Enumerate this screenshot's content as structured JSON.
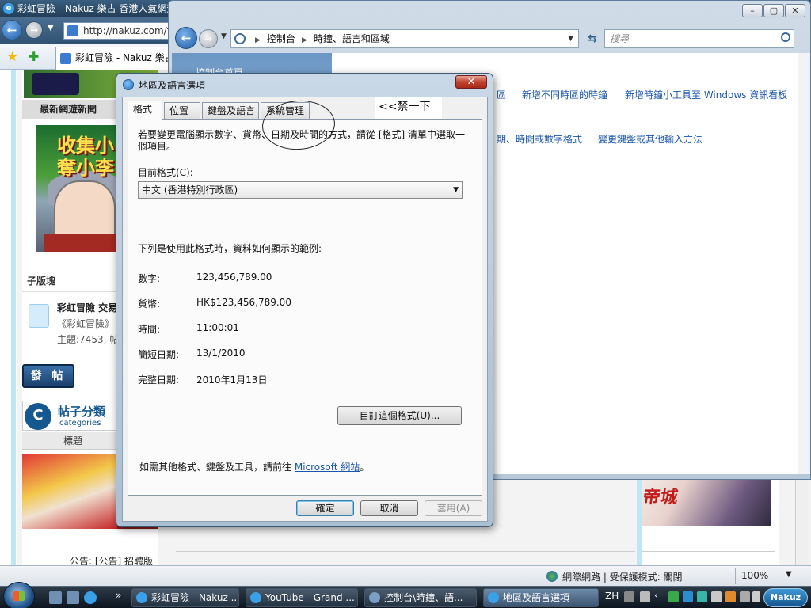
{
  "browser": {
    "title": "彩虹冒險 - Nakuz 樂古 香港人氣網遊",
    "address": "http://nakuz.com/fo",
    "tab_label": "彩虹冒險 - Nakuz 樂古",
    "status_zone": "網際網路 | 受保護模式: 關閉",
    "zoom": "100%"
  },
  "page": {
    "news_header": "最新網遊新聞",
    "comic_line1": "收集小",
    "comic_line2": "奪小李",
    "subforum_header": "子版塊",
    "forum_title": "彩虹冒險 交易",
    "forum_desc": "《彩虹冒險》",
    "forum_meta": "主題:7453, 帖",
    "post_button": "發 帖",
    "categories_title": "帖子分類",
    "categories_sub": "categories",
    "categories_col": "標題",
    "notice": "公告: [公告] 招聘版",
    "right_art_text": "帝城"
  },
  "control_panel": {
    "breadcrumb": [
      "控制台",
      "時鐘、語言和區域"
    ],
    "search_placeholder": "搜尋",
    "side_home": "控制台首頁",
    "links": {
      "row1a": "區",
      "row1b": "新增不同時區的時鐘",
      "row1c": "新增時鐘小工具至 Windows 資訊看板",
      "row2a": "期、時間或數字格式",
      "row2b": "變更鍵盤或其他輸入方法"
    }
  },
  "dialog": {
    "title": "地區及語言選項",
    "close_glyph": "✕",
    "tabs": [
      "格式",
      "位置",
      "鍵盤及語言",
      "系統管理"
    ],
    "annotation": "<<禁一下",
    "description": "若要變更電腦顯示數字、貨幣、日期及時間的方式，請從 [格式] 清單中選取一個項目。",
    "current_format_label": "目前格式(C):",
    "current_format_value": "中文 (香港特別行政區)",
    "examples_intro": "下列是使用此格式時，資料如何顯示的範例:",
    "examples": [
      {
        "label": "數字:",
        "value": "123,456,789.00"
      },
      {
        "label": "貨幣:",
        "value": "HK$123,456,789.00"
      },
      {
        "label": "時間:",
        "value": "11:00:01"
      },
      {
        "label": "簡短日期:",
        "value": "13/1/2010"
      },
      {
        "label": "完整日期:",
        "value": "2010年1月13日"
      }
    ],
    "customize_button": "自訂這個格式(U)...",
    "more_text_prefix": "如需其他格式、鍵盤及工具，請前往",
    "more_link": "Microsoft 網站",
    "more_text_suffix": "。",
    "ok": "確定",
    "cancel": "取消",
    "apply": "套用(A)"
  },
  "taskbar": {
    "buttons": [
      "彩虹冒險 - Nakuz ...",
      "YouTube - Grand ...",
      "控制台\\時鐘、語...",
      "地區及語言選項"
    ],
    "lang": "ZH",
    "clock_label": "Nakuz"
  }
}
